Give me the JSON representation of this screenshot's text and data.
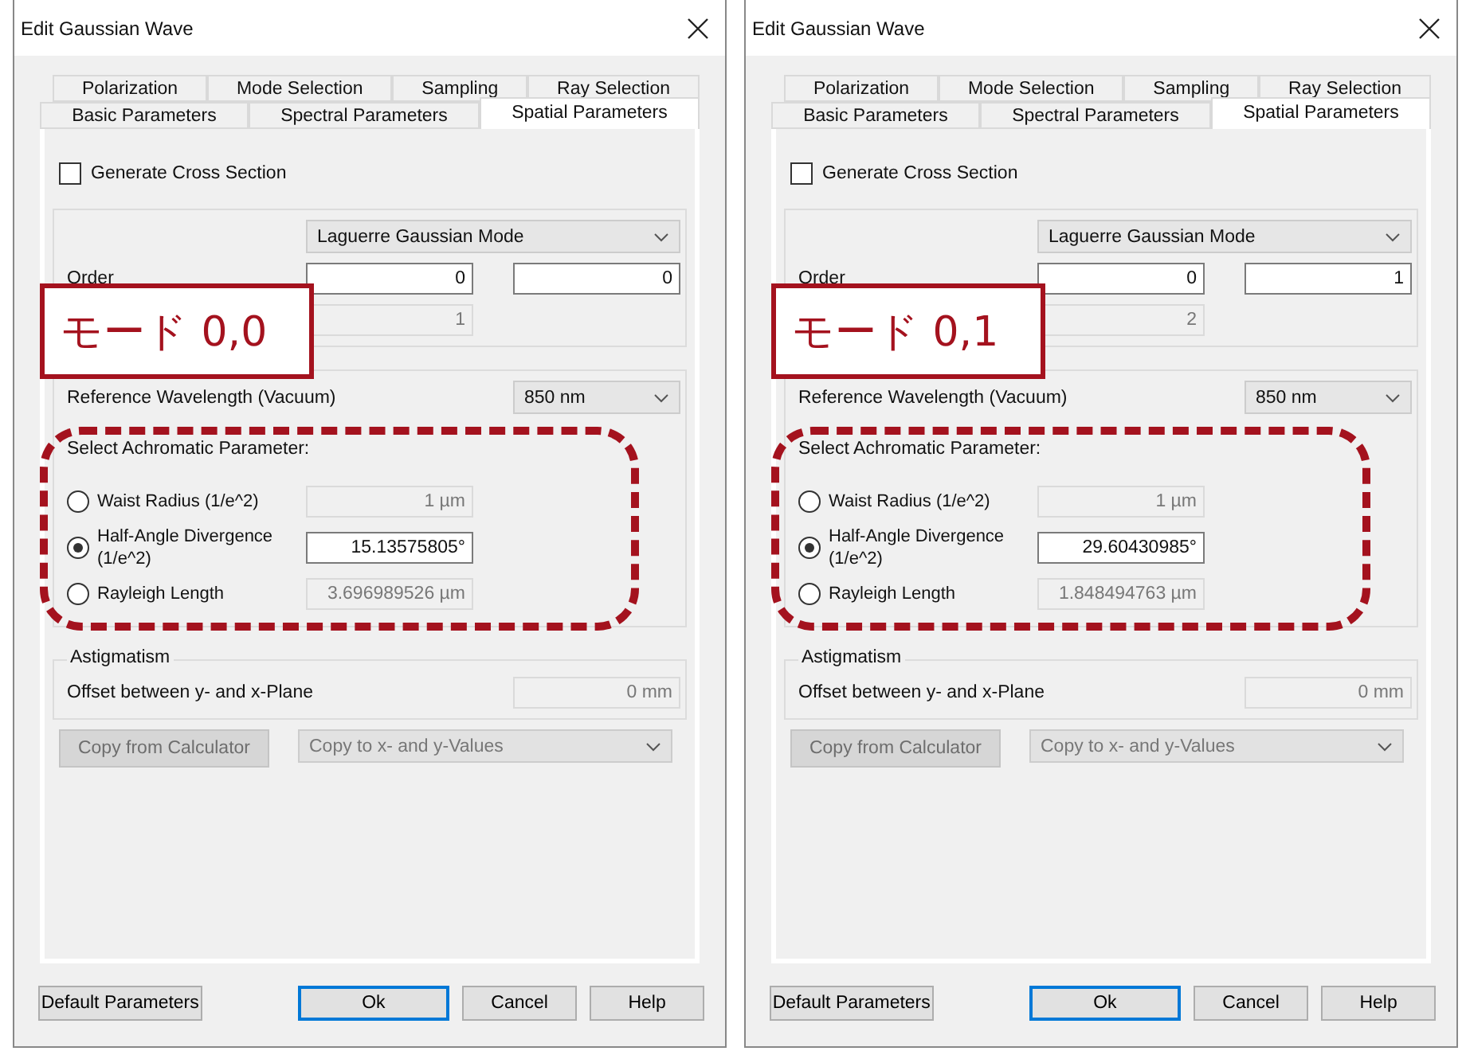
{
  "dialogs": [
    {
      "title": "Edit Gaussian Wave",
      "tab_rows": [
        [
          {
            "label": "Polarization",
            "selected": false
          },
          {
            "label": "Mode Selection",
            "selected": false
          },
          {
            "label": "Sampling",
            "selected": false
          },
          {
            "label": "Ray Selection",
            "selected": false
          }
        ],
        [
          {
            "label": "Basic Parameters",
            "selected": false
          },
          {
            "label": "Spectral Parameters",
            "selected": false
          },
          {
            "label": "Spatial Parameters",
            "selected": true
          }
        ]
      ],
      "cross_section": {
        "label": "Generate Cross Section",
        "checked": false
      },
      "mode_select": "Laguerre Gaussian Mode",
      "order_label": "Order",
      "order_values": [
        "0",
        "0"
      ],
      "m2_value": "1",
      "annotation": "モード 0,0",
      "wavelength_label": "Reference Wavelength (Vacuum)",
      "wavelength_select": "850 nm",
      "achromatic_title": "Select Achromatic Parameter:",
      "options": [
        {
          "label": "Waist Radius (1/e^2)",
          "value": "1 µm",
          "selected": false
        },
        {
          "label": "Half-Angle Divergence (1/e^2)",
          "value": "15.13575805°",
          "selected": true
        },
        {
          "label": "Rayleigh Length",
          "value": "3.696989526 µm",
          "selected": false
        }
      ],
      "astigmatism": {
        "title": "Astigmatism",
        "label": "Offset between y- and x-Plane",
        "value": "0 mm"
      },
      "copy_button": {
        "label": "Copy from Calculator",
        "disabled": true
      },
      "copy_select": {
        "label": "Copy to x- and y-Values",
        "disabled": true
      },
      "footer": [
        {
          "label": "Default Parameters",
          "default": false
        },
        {
          "label": "Ok",
          "default": true
        },
        {
          "label": "Cancel",
          "default": false
        },
        {
          "label": "Help",
          "default": false
        }
      ]
    },
    {
      "title": "Edit Gaussian Wave",
      "tab_rows": [
        [
          {
            "label": "Polarization",
            "selected": false
          },
          {
            "label": "Mode Selection",
            "selected": false
          },
          {
            "label": "Sampling",
            "selected": false
          },
          {
            "label": "Ray Selection",
            "selected": false
          }
        ],
        [
          {
            "label": "Basic Parameters",
            "selected": false
          },
          {
            "label": "Spectral Parameters",
            "selected": false
          },
          {
            "label": "Spatial Parameters",
            "selected": true
          }
        ]
      ],
      "cross_section": {
        "label": "Generate Cross Section",
        "checked": false
      },
      "mode_select": "Laguerre Gaussian Mode",
      "order_label": "Order",
      "order_values": [
        "0",
        "1"
      ],
      "m2_value": "2",
      "annotation": "モード 0,1",
      "wavelength_label": "Reference Wavelength (Vacuum)",
      "wavelength_select": "850 nm",
      "achromatic_title": "Select Achromatic Parameter:",
      "options": [
        {
          "label": "Waist Radius (1/e^2)",
          "value": "1 µm",
          "selected": false
        },
        {
          "label": "Half-Angle Divergence (1/e^2)",
          "value": "29.60430985°",
          "selected": true
        },
        {
          "label": "Rayleigh Length",
          "value": "1.848494763 µm",
          "selected": false
        }
      ],
      "astigmatism": {
        "title": "Astigmatism",
        "label": "Offset between y- and x-Plane",
        "value": "0 mm"
      },
      "copy_button": {
        "label": "Copy from Calculator",
        "disabled": true
      },
      "copy_select": {
        "label": "Copy to x- and y-Values",
        "disabled": true
      },
      "footer": [
        {
          "label": "Default Parameters",
          "default": false
        },
        {
          "label": "Ok",
          "default": true
        },
        {
          "label": "Cancel",
          "default": false
        },
        {
          "label": "Help",
          "default": false
        }
      ]
    }
  ]
}
